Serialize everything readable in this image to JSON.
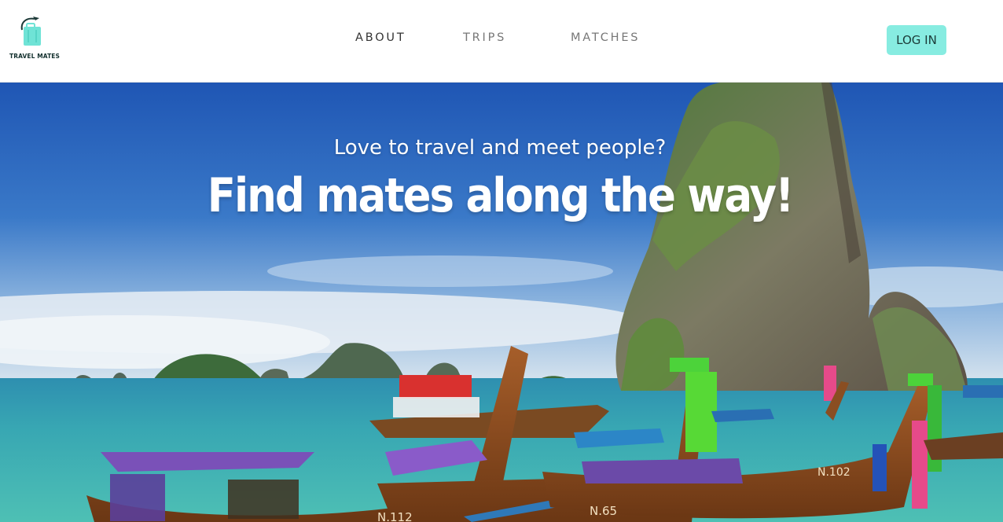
{
  "brand": {
    "name": "TRAVEL MATES",
    "accent_color": "#87ece1",
    "logo_icon": "suitcase-plane-icon"
  },
  "nav": {
    "items": [
      {
        "label": "ABOUT",
        "active": true
      },
      {
        "label": "TRIPS",
        "active": false
      },
      {
        "label": "MATCHES",
        "active": false
      }
    ],
    "login_label": "LOG IN"
  },
  "hero": {
    "subtitle": "Love to travel and meet people?",
    "title": "Find mates along the way!",
    "boat_labels": [
      "N.112",
      "N.65",
      "N.102"
    ]
  }
}
